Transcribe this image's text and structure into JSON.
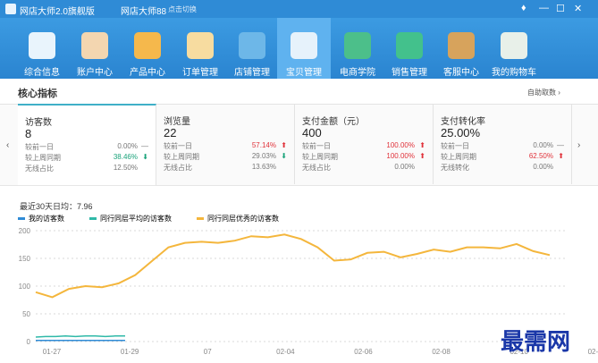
{
  "titlebar": {
    "app_title": "网店大师2.0旗舰版",
    "shop_name": "网店大师88",
    "switch_label": "点击切换",
    "controls": [
      "♦",
      "—",
      "☐",
      "✕"
    ]
  },
  "nav": {
    "items": [
      {
        "label": "综合信息",
        "icon": "monitor-icon",
        "color": "#e9f4fc"
      },
      {
        "label": "账户中心",
        "icon": "user-icon",
        "color": "#f3d6b0"
      },
      {
        "label": "产品中心",
        "icon": "grid-icon",
        "color": "#f5b84c"
      },
      {
        "label": "订单管理",
        "icon": "notepad-icon",
        "color": "#f7dca0"
      },
      {
        "label": "店铺管理",
        "icon": "storefront-icon",
        "color": "#6db7e8"
      },
      {
        "label": "宝贝管理",
        "icon": "wrench-icon",
        "color": "#e6f2fb"
      },
      {
        "label": "电商学院",
        "icon": "graduate-icon",
        "color": "#4cbf8a"
      },
      {
        "label": "销售管理",
        "icon": "bag-icon",
        "color": "#43c18c"
      },
      {
        "label": "客服中心",
        "icon": "book-icon",
        "color": "#d7a35c"
      },
      {
        "label": "我的购物车",
        "icon": "cart-icon",
        "color": "#e8f0e9"
      }
    ],
    "active_index": 5
  },
  "panel": {
    "title": "核心指标",
    "link": "自助取数 ›"
  },
  "metrics": [
    {
      "title": "访客数",
      "value": "8",
      "rows": [
        {
          "label": "较前一日",
          "value": "0.00%",
          "mark": "—",
          "trend": "flat"
        },
        {
          "label": "较上周同期",
          "value": "38.46%",
          "mark": "⬇",
          "trend": "down"
        },
        {
          "label": "无线占比",
          "value": "12.50%",
          "mark": "",
          "trend": "flat"
        }
      ]
    },
    {
      "title": "浏览量",
      "value": "22",
      "rows": [
        {
          "label": "较前一日",
          "value": "57.14%",
          "mark": "⬆",
          "trend": "up"
        },
        {
          "label": "较上周同期",
          "value": "29.03%",
          "mark": "⬇",
          "trend": "down"
        },
        {
          "label": "无线占比",
          "value": "13.63%",
          "mark": "",
          "trend": "flat"
        }
      ]
    },
    {
      "title": "支付金额（元）",
      "value": "400",
      "rows": [
        {
          "label": "较前一日",
          "value": "100.00%",
          "mark": "⬆",
          "trend": "up"
        },
        {
          "label": "较上周同期",
          "value": "100.00%",
          "mark": "⬆",
          "trend": "up"
        },
        {
          "label": "无线占比",
          "value": "0.00%",
          "mark": "",
          "trend": "flat"
        }
      ]
    },
    {
      "title": "支付转化率",
      "value": "25.00%",
      "rows": [
        {
          "label": "较前一日",
          "value": "0.00%",
          "mark": "—",
          "trend": "flat"
        },
        {
          "label": "较上周同期",
          "value": "62.50%",
          "mark": "⬆",
          "trend": "up"
        },
        {
          "label": "无线转化",
          "value": "0.00%",
          "mark": "",
          "trend": "flat"
        }
      ]
    }
  ],
  "chart_header": {
    "avg_text": "最近30天日均：7.96"
  },
  "watermark": "最需网",
  "chart_data": {
    "type": "line",
    "ylim": [
      0,
      200
    ],
    "y_ticks": [
      "0",
      "50",
      "100",
      "150",
      "200"
    ],
    "x_ticks": [
      "01-27",
      "01-29",
      "07",
      "02-04",
      "02-06",
      "02-08",
      "02-10",
      "02-12"
    ],
    "grid": true,
    "legend_position": "top-left",
    "series": [
      {
        "name": "我的访客数",
        "color": "#2f8bd6",
        "values": [
          2,
          2,
          2,
          2,
          2,
          2,
          2,
          2,
          2,
          2
        ]
      },
      {
        "name": "同行同层平均的访客数",
        "color": "#2fb9a8",
        "values": [
          8,
          9,
          9,
          10,
          9,
          10,
          10,
          9,
          10,
          10
        ]
      },
      {
        "name": "同行同层优秀的访客数",
        "color": "#f4b63c",
        "values": [
          89,
          80,
          95,
          100,
          98,
          105,
          120,
          145,
          170,
          178,
          180,
          178,
          182,
          190,
          188,
          193,
          185,
          170,
          146,
          148,
          160,
          162,
          152,
          158,
          166,
          162,
          170,
          170,
          168,
          176,
          163,
          156
        ]
      }
    ]
  }
}
